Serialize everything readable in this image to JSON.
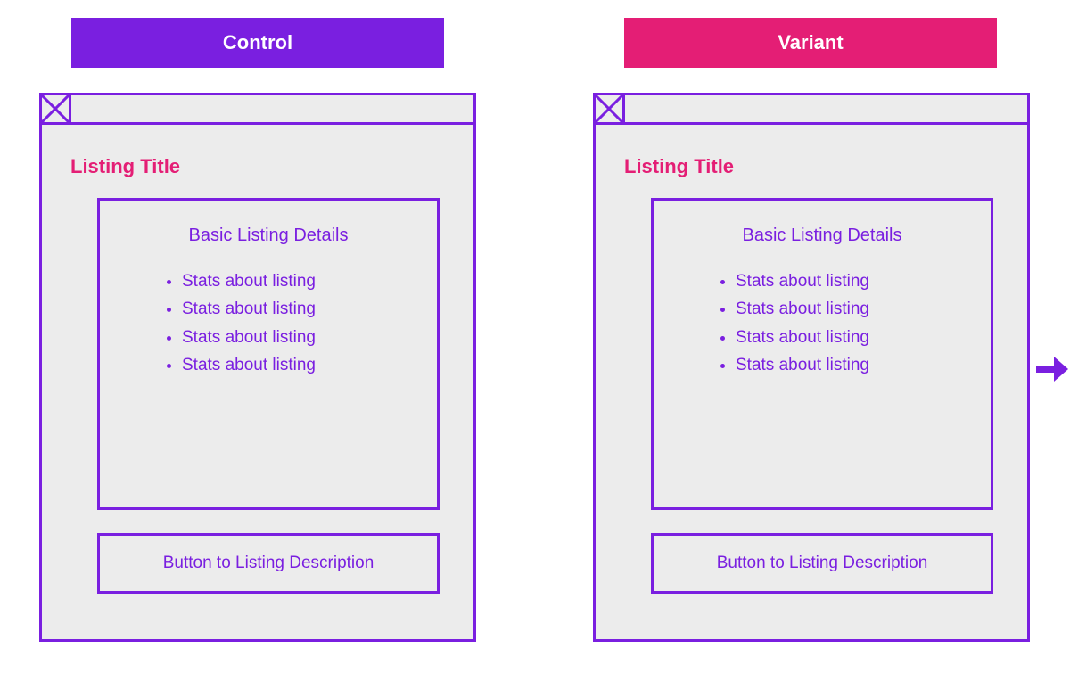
{
  "headers": {
    "control": "Control",
    "variant": "Variant"
  },
  "listing": {
    "title": "Listing Title",
    "details_heading": "Basic Listing Details",
    "stats": [
      "Stats about listing",
      "Stats about listing",
      "Stats about listing",
      "Stats about listing"
    ],
    "cta": "Button to Listing Description"
  },
  "colors": {
    "purple": "#7A1FE0",
    "pink": "#E41E75",
    "panel": "#ECECEC"
  }
}
